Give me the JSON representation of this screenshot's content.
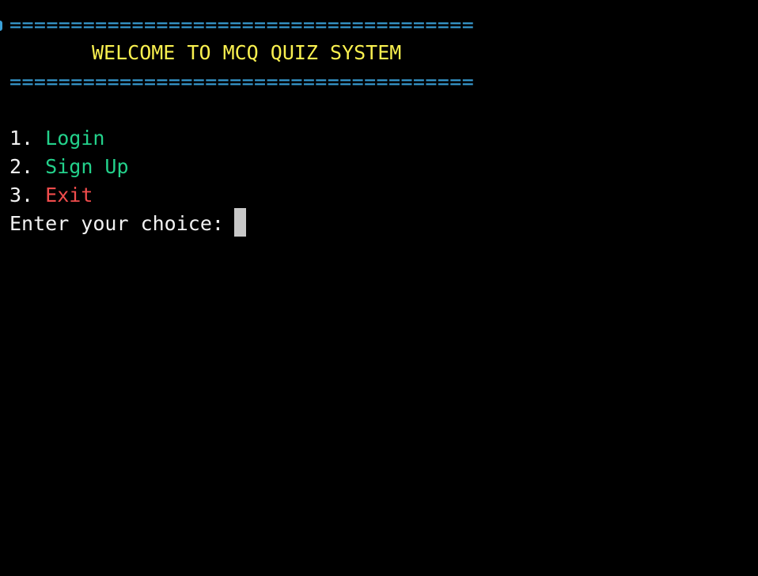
{
  "terminal": {
    "separator_top": "======================================",
    "welcome": "WELCOME TO MCQ QUIZ SYSTEM",
    "separator_bottom": "======================================",
    "menu": [
      {
        "num": "1.",
        "label": "Login"
      },
      {
        "num": "2.",
        "label": "Sign Up"
      },
      {
        "num": "3.",
        "label": "Exit"
      }
    ],
    "prompt": "Enter your choice: ",
    "input_value": ""
  },
  "colors": {
    "background": "#000000",
    "separator": "#3aa0d8",
    "welcome": "#f9f04f",
    "option_green": "#23d18b",
    "option_red": "#f14c4c",
    "text": "#f2f2f2",
    "cursor": "#c8c8c8"
  }
}
